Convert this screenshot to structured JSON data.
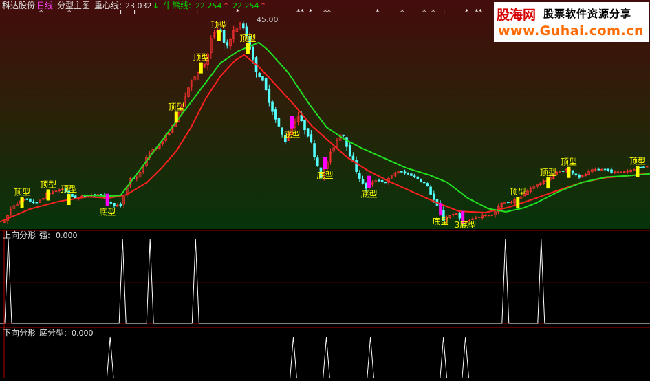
{
  "header": {
    "stock_name": "科达股份",
    "period": "日线",
    "indicator_name": "分型主图",
    "center_line_label": "重心线:",
    "center_line_value": "23.032",
    "center_line_arrow": "↓",
    "bull_bear_label": "牛熊线:",
    "bull_bear_value": "22.254",
    "bull_bear_arrow": "↑",
    "third_value": "22.254",
    "third_arrow": "↑"
  },
  "watermark": {
    "brand": "股海网",
    "slogan": "股票软件资源分享",
    "url": "www.Guhai.com.cn"
  },
  "panels": {
    "up": {
      "title": "上向分形",
      "label": "强:",
      "value": "0.000"
    },
    "down": {
      "title": "下向分形",
      "label": "底分型:",
      "value": "0.000"
    }
  },
  "colors": {
    "up_candle": "#ff3232",
    "down_candle": "#54ffff",
    "center_line": "#ff2020",
    "bull_bear_line": "#20e020",
    "top_marker": "#ffff00",
    "bottom_marker": "#ff00ff",
    "fractal_line": "#ffffff",
    "separator": "#b00000"
  },
  "chart_data": {
    "type": "candlestick",
    "price_annotation": "45.00",
    "ylim": [
      14,
      47
    ],
    "bars": 200,
    "price_path": [
      [
        0,
        14.8
      ],
      [
        6,
        17.3
      ],
      [
        14,
        18.2
      ],
      [
        22,
        17.6
      ],
      [
        30,
        19.1
      ],
      [
        40,
        19.8
      ],
      [
        48,
        18.4
      ],
      [
        58,
        18.8
      ],
      [
        66,
        19.0
      ],
      [
        74,
        17.4
      ],
      [
        80,
        17.2
      ],
      [
        86,
        21.3
      ],
      [
        92,
        21.6
      ],
      [
        100,
        25.4
      ],
      [
        108,
        26.8
      ],
      [
        114,
        28.6
      ],
      [
        120,
        31.2
      ],
      [
        126,
        35.0
      ],
      [
        132,
        37.4
      ],
      [
        138,
        39.0
      ],
      [
        143,
        43.2
      ],
      [
        148,
        44.4
      ],
      [
        152,
        41.0
      ],
      [
        157,
        43.6
      ],
      [
        163,
        45.0
      ],
      [
        167,
        43.0
      ],
      [
        172,
        38.4
      ],
      [
        178,
        36.0
      ],
      [
        186,
        30.7
      ],
      [
        193,
        27.0
      ],
      [
        202,
        31.0
      ],
      [
        210,
        27.5
      ],
      [
        218,
        21.5
      ],
      [
        225,
        25.5
      ],
      [
        232,
        28.7
      ],
      [
        240,
        23.6
      ],
      [
        248,
        19.8
      ],
      [
        256,
        21.2
      ],
      [
        262,
        20.8
      ],
      [
        270,
        22.5
      ],
      [
        280,
        21.9
      ],
      [
        290,
        20.6
      ],
      [
        297,
        17.4
      ],
      [
        302,
        15.1
      ],
      [
        310,
        16.2
      ],
      [
        316,
        14.6
      ],
      [
        322,
        15.2
      ],
      [
        330,
        15.9
      ],
      [
        336,
        15.8
      ],
      [
        342,
        17.6
      ],
      [
        350,
        17.9
      ],
      [
        356,
        18.7
      ],
      [
        364,
        20.2
      ],
      [
        372,
        21.0
      ],
      [
        380,
        22.3
      ],
      [
        388,
        22.8
      ],
      [
        396,
        21.5
      ],
      [
        404,
        22.6
      ],
      [
        412,
        22.8
      ],
      [
        420,
        22.3
      ],
      [
        428,
        22.5
      ],
      [
        436,
        23.0
      ],
      [
        442,
        23.3
      ]
    ],
    "center_path": [
      [
        0,
        14.8
      ],
      [
        20,
        16.7
      ],
      [
        40,
        17.9
      ],
      [
        60,
        18.6
      ],
      [
        74,
        18.4
      ],
      [
        86,
        18.9
      ],
      [
        100,
        20.8
      ],
      [
        110,
        23.0
      ],
      [
        120,
        25.6
      ],
      [
        130,
        29.2
      ],
      [
        140,
        33.6
      ],
      [
        150,
        37.0
      ],
      [
        160,
        39.4
      ],
      [
        166,
        40.2
      ],
      [
        176,
        38.4
      ],
      [
        186,
        36.0
      ],
      [
        200,
        32.6
      ],
      [
        212,
        29.4
      ],
      [
        224,
        27.0
      ],
      [
        236,
        24.6
      ],
      [
        250,
        22.6
      ],
      [
        264,
        21.0
      ],
      [
        280,
        19.4
      ],
      [
        296,
        17.8
      ],
      [
        312,
        16.4
      ],
      [
        330,
        16.2
      ],
      [
        346,
        17.0
      ],
      [
        362,
        18.2
      ],
      [
        380,
        19.6
      ],
      [
        396,
        20.8
      ],
      [
        412,
        21.5
      ],
      [
        428,
        21.8
      ],
      [
        442,
        22.2
      ]
    ],
    "bull_path": [
      [
        56,
        18.8
      ],
      [
        64,
        18.8
      ],
      [
        74,
        18.7
      ],
      [
        82,
        18.8
      ],
      [
        150,
        39.0
      ],
      [
        162,
        40.8
      ],
      [
        176,
        42.1
      ],
      [
        182,
        41.0
      ],
      [
        196,
        37.5
      ],
      [
        210,
        32.8
      ],
      [
        222,
        29.2
      ],
      [
        234,
        27.4
      ],
      [
        246,
        26.0
      ],
      [
        262,
        24.4
      ],
      [
        276,
        23.0
      ],
      [
        292,
        21.9
      ],
      [
        304,
        20.8
      ],
      [
        318,
        18.4
      ],
      [
        332,
        16.8
      ],
      [
        344,
        16.3
      ],
      [
        356,
        16.9
      ],
      [
        364,
        17.6
      ],
      [
        380,
        19.4
      ],
      [
        396,
        20.8
      ],
      [
        412,
        21.6
      ],
      [
        428,
        21.8
      ],
      [
        442,
        22.1
      ]
    ],
    "top_fractals": [
      {
        "idx": 16,
        "label": "顶型"
      },
      {
        "idx": 35,
        "label": "顶型"
      },
      {
        "idx": 50,
        "label": "顶型"
      },
      {
        "idx": 128,
        "label": "顶型"
      },
      {
        "idx": 146,
        "label": "顶型"
      },
      {
        "idx": 159,
        "label": "顶型"
      },
      {
        "idx": 180,
        "label": "顶型"
      },
      {
        "idx": 376,
        "label": "顶型"
      },
      {
        "idx": 398,
        "label": "顶型"
      },
      {
        "idx": 413,
        "label": "顶型"
      },
      {
        "idx": 463,
        "label": "顶型"
      }
    ],
    "bottom_fractals": [
      {
        "idx": 78,
        "label": "底型"
      },
      {
        "idx": 212,
        "label": "底型"
      },
      {
        "idx": 236,
        "label": "底型"
      },
      {
        "idx": 268,
        "label": "底型"
      },
      {
        "idx": 320,
        "label": "底型"
      },
      {
        "idx": 336,
        "label": "3底型"
      }
    ],
    "upper_panel": {
      "title": "上向分形",
      "series": "强",
      "value": 0.0,
      "spikes_at": [
        6,
        89,
        109,
        142,
        367,
        393
      ]
    },
    "lower_panel": {
      "title": "下向分形",
      "series": "底分型",
      "value": 0.0,
      "spikes_at": [
        80,
        213,
        237,
        269,
        322,
        338
      ]
    },
    "top_marks": [
      {
        "x": 57,
        "glyph": "*"
      },
      {
        "x": 98,
        "glyph": "*"
      },
      {
        "x": 171,
        "glyph": "+"
      },
      {
        "x": 191,
        "glyph": "+"
      },
      {
        "x": 282,
        "glyph": "+"
      },
      {
        "x": 343,
        "glyph": "*"
      },
      {
        "x": 431,
        "glyph": "**"
      },
      {
        "x": 449,
        "glyph": "*"
      },
      {
        "x": 470,
        "glyph": "**"
      },
      {
        "x": 546,
        "glyph": "*"
      },
      {
        "x": 582,
        "glyph": "*"
      },
      {
        "x": 614,
        "glyph": "*"
      },
      {
        "x": 627,
        "glyph": "*"
      },
      {
        "x": 641,
        "glyph": "+"
      },
      {
        "x": 676,
        "glyph": "*"
      },
      {
        "x": 690,
        "glyph": "**"
      }
    ]
  }
}
